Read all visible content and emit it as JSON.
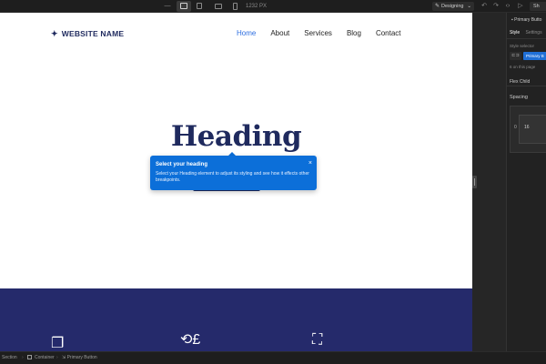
{
  "toolbar": {
    "canvas_width": "1232 PX",
    "mode_label": "Designing",
    "right_label": "Sh"
  },
  "site": {
    "logo_text": "WEBSITE NAME",
    "nav": [
      {
        "label": "Home",
        "active": true
      },
      {
        "label": "About",
        "active": false
      },
      {
        "label": "Services",
        "active": false
      },
      {
        "label": "Blog",
        "active": false
      },
      {
        "label": "Contact",
        "active": false
      }
    ],
    "heading": "Heading"
  },
  "tooltip": {
    "title": "Select your heading",
    "body": "Select your Heading element to adjust its styling and see how it effects other breakpoints.",
    "close": "×"
  },
  "panel": {
    "selected_element": "Primary Butto",
    "tabs": [
      "Style",
      "Settings"
    ],
    "style_selector_label": "Style selector",
    "class_chip": "Primary B",
    "on_page": "6 on this page",
    "flex_child": "Flex Child",
    "spacing": "Spacing",
    "margin_left": "0",
    "padding_value": "16"
  },
  "breadcrumbs": [
    "Section",
    "Container",
    "Primary Button"
  ],
  "colors": {
    "accent": "#2d6ee0",
    "brand_navy": "#1f2a5e",
    "section_blue": "#252a6b",
    "tooltip_blue": "#0c6fd9"
  }
}
